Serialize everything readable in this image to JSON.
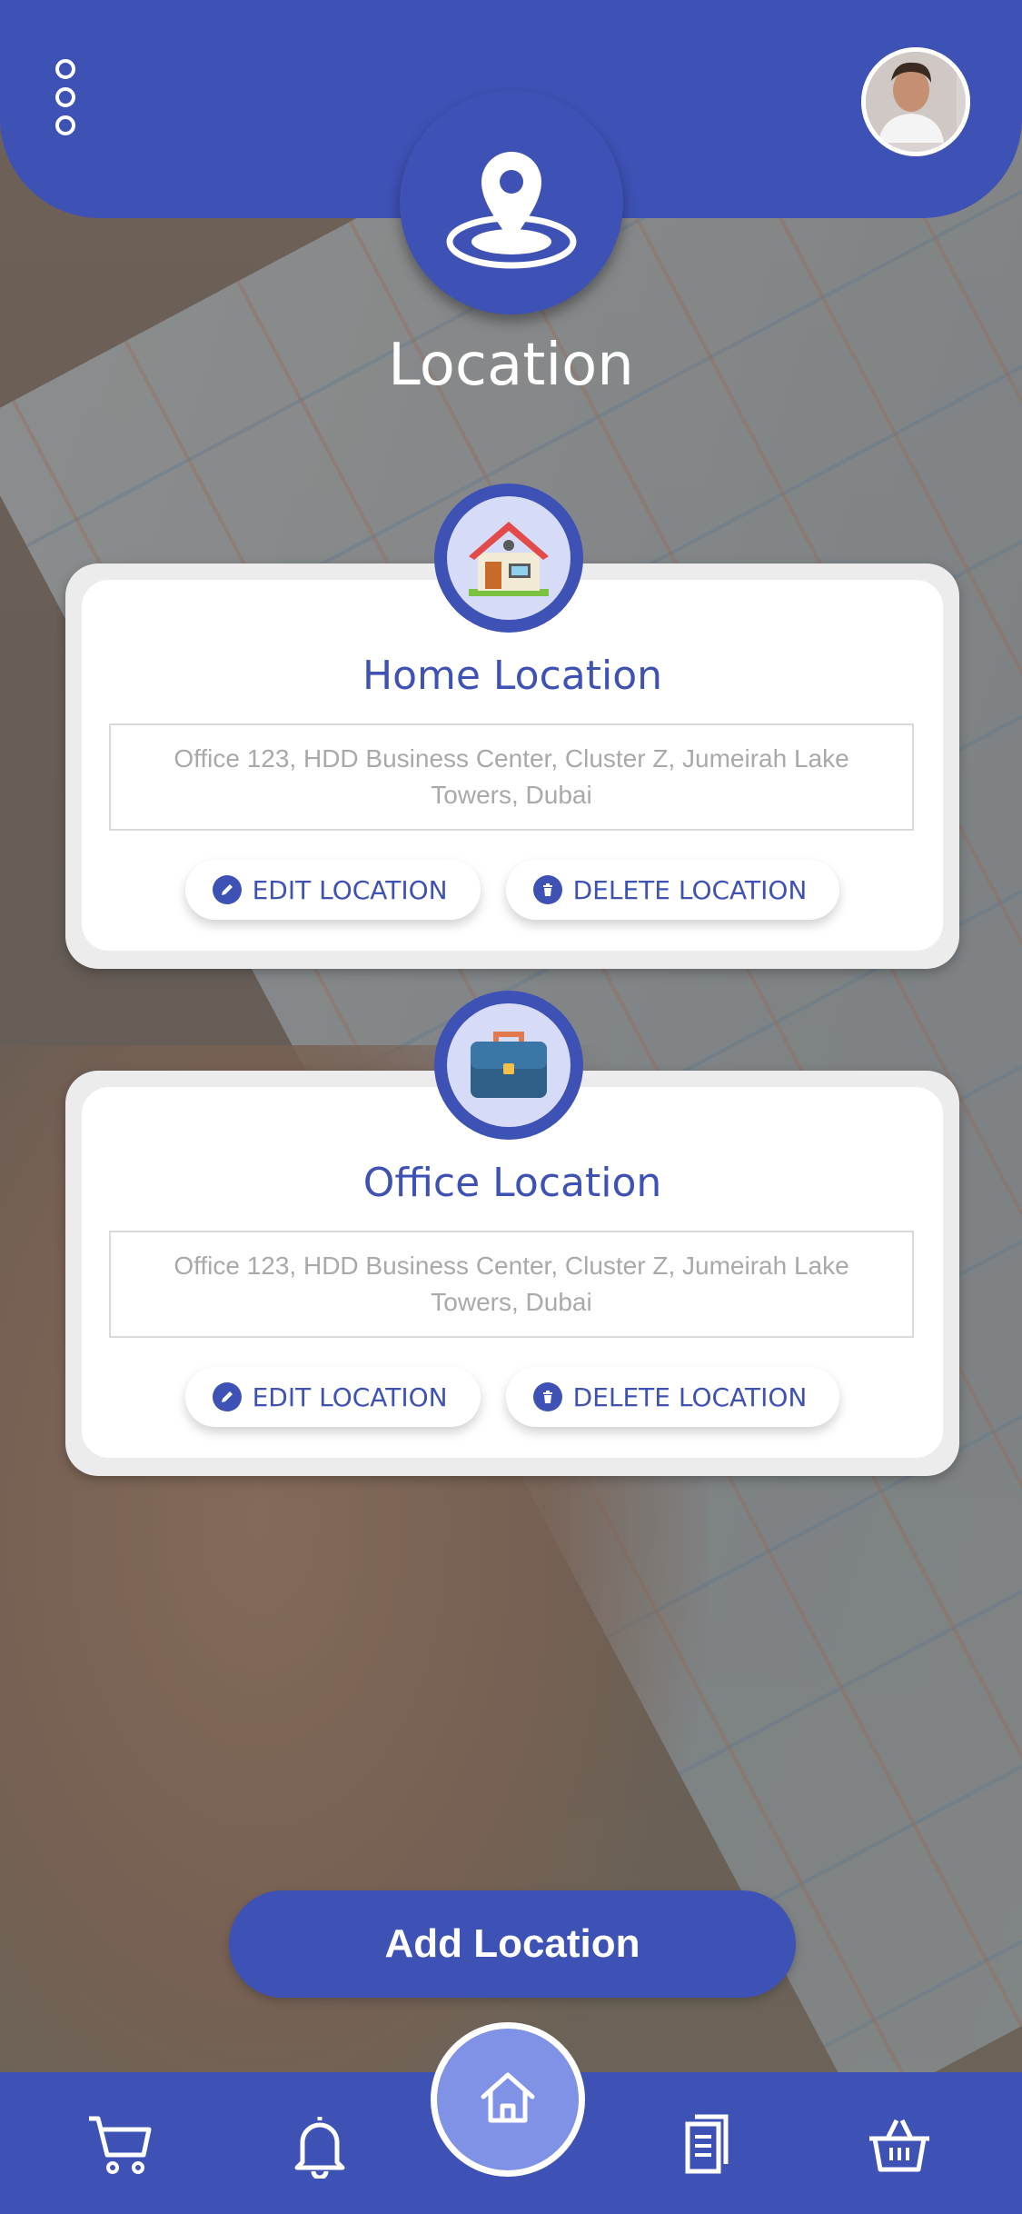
{
  "header": {
    "title": "Location",
    "menu_icon": "more-vertical-icon",
    "pin_icon": "location-pin-icon"
  },
  "cards": [
    {
      "title": "Home Location",
      "icon": "house-icon",
      "address": "Office 123, HDD Business Center, Cluster Z, Jumeirah Lake Towers, Dubai",
      "edit_label": "EDIT LOCATION",
      "delete_label": "DELETE LOCATION"
    },
    {
      "title": "Office Location",
      "icon": "briefcase-icon",
      "address": "Office 123, HDD Business Center, Cluster Z, Jumeirah Lake Towers, Dubai",
      "edit_label": "EDIT LOCATION",
      "delete_label": "DELETE LOCATION"
    }
  ],
  "add_button_label": "Add Location",
  "bottom_nav": [
    "cart-icon",
    "bell-icon",
    "home-icon",
    "document-icon",
    "basket-icon"
  ],
  "colors": {
    "primary": "#3e51b5",
    "home_button": "#7f92e6",
    "address_text": "#a9a9a9"
  }
}
